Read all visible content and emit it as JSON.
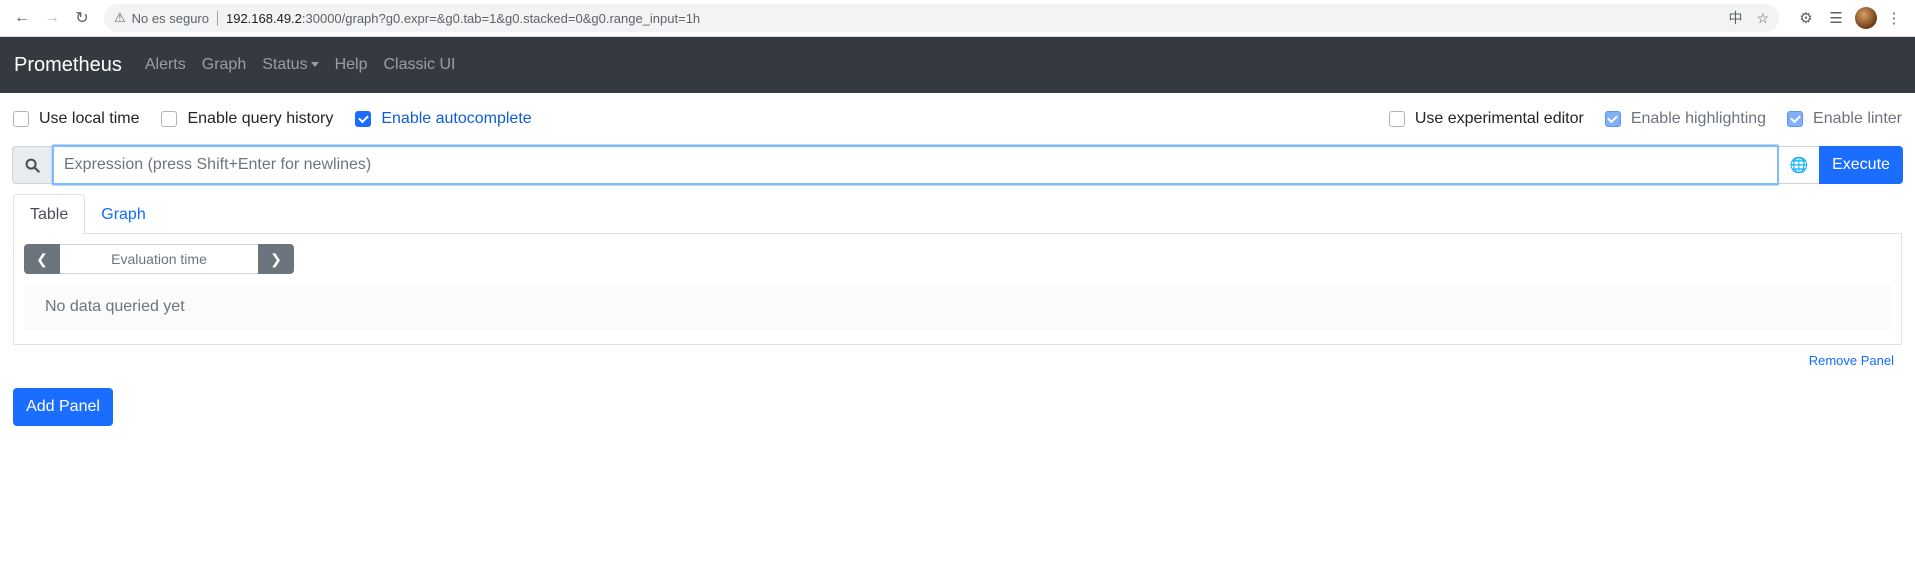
{
  "browser": {
    "security_text": "No es seguro",
    "url_host": "192.168.49.2",
    "url_path": ":30000/graph?g0.expr=&g0.tab=1&g0.stacked=0&g0.range_input=1h"
  },
  "navbar": {
    "brand": "Prometheus",
    "links": [
      "Alerts",
      "Graph",
      "Status",
      "Help",
      "Classic UI"
    ]
  },
  "options": {
    "left": [
      {
        "label": "Use local time",
        "checked": false
      },
      {
        "label": "Enable query history",
        "checked": false
      },
      {
        "label": "Enable autocomplete",
        "checked": true
      }
    ],
    "right": [
      {
        "label": "Use experimental editor",
        "checked": false
      },
      {
        "label": "Enable highlighting",
        "checked": true
      },
      {
        "label": "Enable linter",
        "checked": true
      }
    ]
  },
  "expression": {
    "placeholder": "Expression (press Shift+Enter for newlines)",
    "value": "",
    "execute_label": "Execute"
  },
  "tabs": [
    "Table",
    "Graph"
  ],
  "panel": {
    "eval_time_placeholder": "Evaluation time",
    "no_data": "No data queried yet",
    "remove_label": "Remove Panel"
  },
  "add_panel_label": "Add Panel",
  "colors": {
    "navbar_bg": "#343a40",
    "primary": "#1a6dff",
    "link": "#0d6efd"
  }
}
